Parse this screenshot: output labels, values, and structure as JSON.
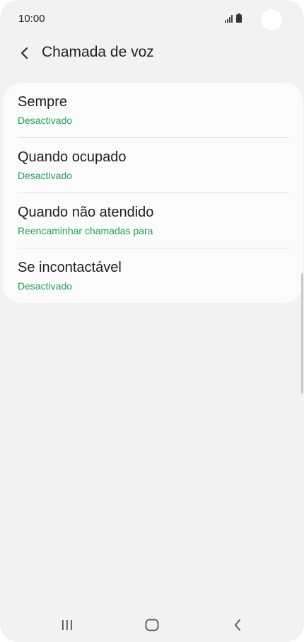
{
  "status_bar": {
    "time": "10:00"
  },
  "header": {
    "back_icon": "chevron-left-icon",
    "title": "Chamada de voz"
  },
  "items": [
    {
      "title": "Sempre",
      "subtitle": "Desactivado"
    },
    {
      "title": "Quando ocupado",
      "subtitle": "Desactivado"
    },
    {
      "title": "Quando não atendido",
      "subtitle": "Reencaminhar chamadas para"
    },
    {
      "title": "Se incontactável",
      "subtitle": "Desactivado"
    }
  ],
  "nav_bar": {
    "recents_icon": "recent-apps-icon",
    "home_icon": "home-icon",
    "back_icon": "back-icon"
  },
  "colors": {
    "background": "#f2f2f2",
    "card": "#fbfbfb",
    "accent_green": "#1e9e5a",
    "text_primary": "#1f1f1f"
  }
}
